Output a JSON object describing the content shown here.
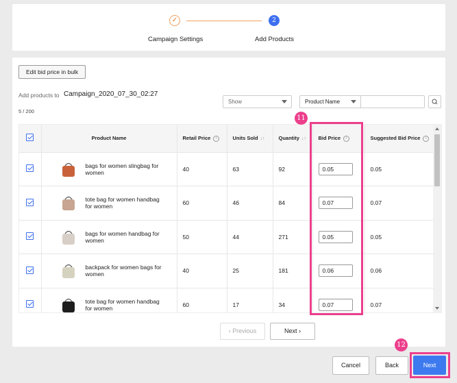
{
  "stepper": {
    "step1": {
      "label": "Campaign Settings",
      "icon": "check-icon",
      "color": "#e87722"
    },
    "step2": {
      "label": "Add Products",
      "number": "2",
      "color": "#3d6ff0"
    }
  },
  "toolbar": {
    "bulk_label": "Edit bid price in bulk",
    "add_label": "Add products to",
    "campaign_name": "Campaign_2020_07_30_02:27",
    "count": "5 / 200"
  },
  "filters": {
    "show_label": "Show",
    "field_label": "Product Name",
    "search_placeholder": ""
  },
  "table": {
    "headers": {
      "product_name": "Product Name",
      "retail_price": "Retail Price",
      "units_sold": "Units Sold",
      "quantity": "Quantity",
      "bid_price": "Bid Price",
      "suggested_bid_price": "Suggested Bid Price"
    },
    "rows": [
      {
        "name": "bags for women slingbag for women",
        "retail_price": "40",
        "units_sold": "63",
        "quantity": "92",
        "bid_price": "0.05",
        "suggested": "0.05",
        "thumb_color": "#c9623a"
      },
      {
        "name": "tote bag for women handbag for women",
        "retail_price": "60",
        "units_sold": "46",
        "quantity": "84",
        "bid_price": "0.07",
        "suggested": "0.07",
        "thumb_color": "#c8a592"
      },
      {
        "name": "bags for women handbag for women",
        "retail_price": "50",
        "units_sold": "44",
        "quantity": "271",
        "bid_price": "0.05",
        "suggested": "0.05",
        "thumb_color": "#d8cfc8"
      },
      {
        "name": "backpack for women bags for women",
        "retail_price": "40",
        "units_sold": "25",
        "quantity": "181",
        "bid_price": "0.06",
        "suggested": "0.06",
        "thumb_color": "#d6d2c0"
      },
      {
        "name": "tote bag for women handbag for women",
        "retail_price": "60",
        "units_sold": "17",
        "quantity": "34",
        "bid_price": "0.07",
        "suggested": "0.07",
        "thumb_color": "#1e1e1e"
      }
    ]
  },
  "pagination": {
    "prev_label": "Previous",
    "next_label": "Next"
  },
  "annotations": {
    "badge1": "11",
    "badge2": "12",
    "color": "#ec3f8c"
  },
  "footer": {
    "cancel_label": "Cancel",
    "back_label": "Back",
    "next_label": "Next",
    "next_color": "#3d7af0"
  }
}
